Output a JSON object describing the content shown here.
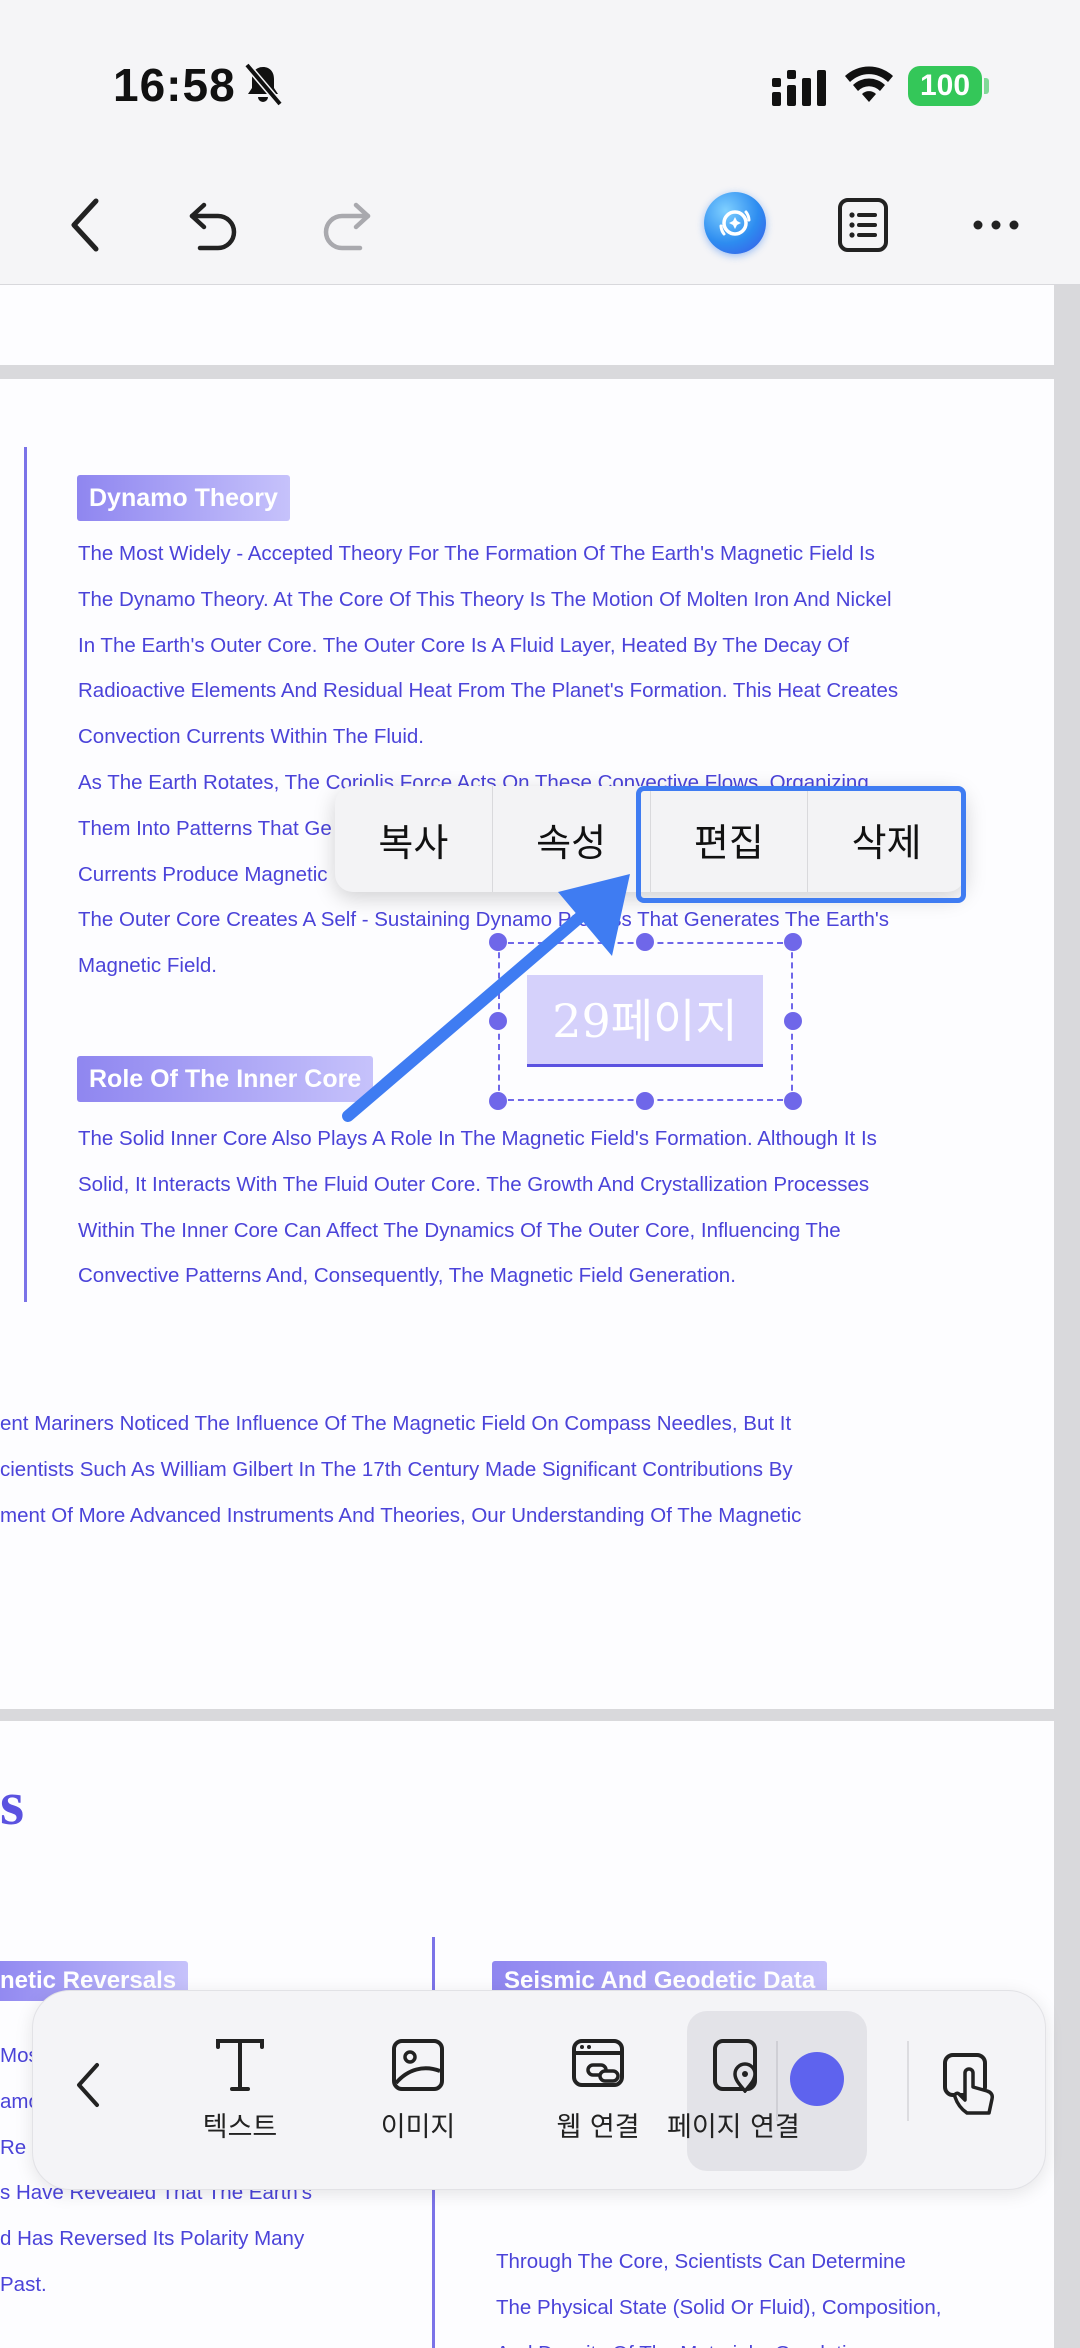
{
  "status_bar": {
    "time": "16:58",
    "battery": "100"
  },
  "toolbar": {
    "back_icon": "chevron-left-icon",
    "undo_icon": "undo-icon",
    "redo_icon": "redo-icon",
    "ai_icon": "ai-assistant-icon",
    "outline_icon": "list-icon",
    "more_icon": "more-icon"
  },
  "document": {
    "sections": [
      {
        "heading": "Dynamo Theory",
        "lines": [
          "The Most Widely - Accepted Theory For The Formation Of The Earth's Magnetic Field Is",
          "The Dynamo Theory. At The Core Of This Theory Is The Motion Of Molten Iron And Nickel",
          "In The Earth's Outer Core. The Outer Core Is A Fluid Layer, Heated By The Decay Of",
          "Radioactive Elements And Residual Heat From The Planet's Formation. This Heat Creates",
          "Convection Currents Within The Fluid.",
          "As The Earth Rotates, The Coriolis Force Acts On These Convective Flows, Organizing",
          "Them Into Patterns That Ge",
          "Currents Produce Magnetic",
          "The Outer Core Creates A Self - Sustaining Dynamo Process That Generates The Earth's",
          "Magnetic Field."
        ]
      },
      {
        "heading": "Role Of The Inner Core",
        "lines": [
          "The Solid Inner Core Also Plays A Role In The Magnetic Field's Formation. Although It Is",
          "Solid, It Interacts With The Fluid Outer Core. The Growth And Crystallization Processes",
          "Within The Inner Core Can Affect The Dynamics Of The Outer Core, Influencing The",
          "Convective Patterns And, Consequently, The Magnetic Field Generation."
        ]
      }
    ],
    "history_lines": [
      "ent Mariners Noticed The Influence Of The Magnetic Field On Compass Needles, But It",
      "cientists Such As William Gilbert In The 17th Century Made Significant Contributions By",
      "ment Of More Advanced Instruments And Theories, Our Understanding Of The Magnetic"
    ],
    "selected_text": "29페이지",
    "page3": {
      "big_letter": "s",
      "left_heading": "netic Reversals",
      "right_heading": "Seismic And Geodetic Data",
      "left_lines": [
        "Mos",
        "amo",
        " Re",
        "s Have Revealed That The Earth's",
        "d Has Reversed Its Polarity Many",
        " Past."
      ],
      "right_lines": [
        "Through The Core, Scientists Can Determine",
        "The Physical State (Solid Or Fluid), Composition,",
        "And Density Of The Materials. Geodetic"
      ]
    }
  },
  "popup_menu": {
    "items": [
      "복사",
      "속성",
      "편집",
      "삭제"
    ]
  },
  "bottom_toolbar": {
    "items": [
      {
        "label": "텍스트",
        "icon": "text-icon"
      },
      {
        "label": "이미지",
        "icon": "image-icon"
      },
      {
        "label": "웹 연결",
        "icon": "web-link-icon"
      },
      {
        "label": "페이지 연결",
        "icon": "page-link-icon"
      }
    ],
    "active_color": "#5e63ee",
    "accent": "#3f7cf2"
  }
}
